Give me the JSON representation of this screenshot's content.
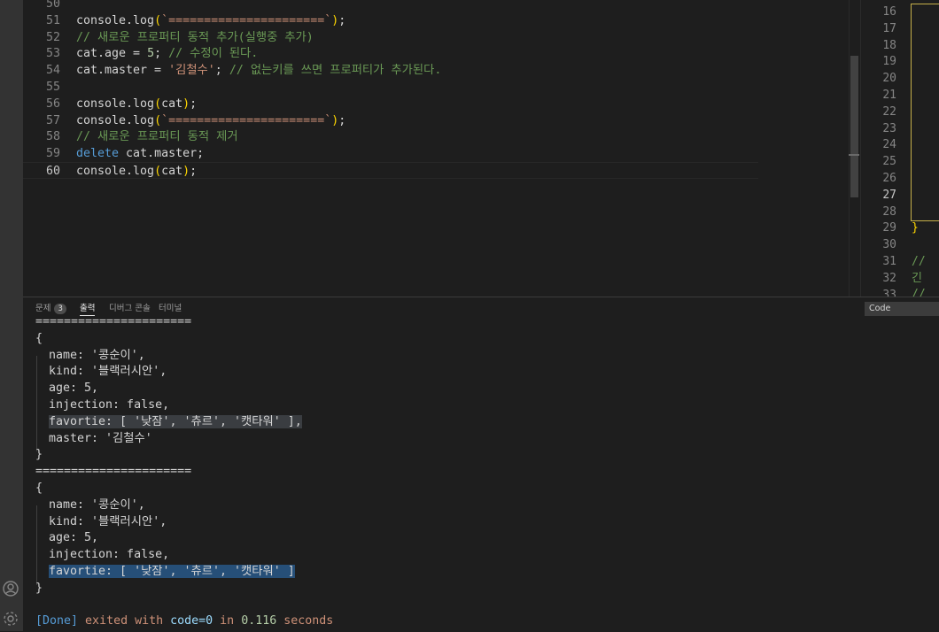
{
  "editor": {
    "lines": [
      {
        "num": "50",
        "tokens": []
      },
      {
        "num": "51",
        "tokens": [
          {
            "t": "console.log",
            "c": "tk-default"
          },
          {
            "t": "(",
            "c": "tk-punct"
          },
          {
            "t": "`======================`",
            "c": "tk-string"
          },
          {
            "t": ")",
            "c": "tk-punct"
          },
          {
            "t": ";",
            "c": "tk-default"
          }
        ]
      },
      {
        "num": "52",
        "tokens": [
          {
            "t": "// 새로운 프로퍼티 동적 추가(실행중 추가)",
            "c": "tk-comment"
          }
        ]
      },
      {
        "num": "53",
        "tokens": [
          {
            "t": "cat.age = ",
            "c": "tk-default"
          },
          {
            "t": "5",
            "c": "tk-number"
          },
          {
            "t": "; ",
            "c": "tk-default"
          },
          {
            "t": "// 수정이 된다.",
            "c": "tk-comment"
          }
        ]
      },
      {
        "num": "54",
        "tokens": [
          {
            "t": "cat.master = ",
            "c": "tk-default"
          },
          {
            "t": "'김철수'",
            "c": "tk-string"
          },
          {
            "t": "; ",
            "c": "tk-default"
          },
          {
            "t": "// 없는키를 쓰면 프로퍼티가 추가된다.",
            "c": "tk-comment"
          }
        ]
      },
      {
        "num": "55",
        "tokens": []
      },
      {
        "num": "56",
        "tokens": [
          {
            "t": "console.log",
            "c": "tk-default"
          },
          {
            "t": "(",
            "c": "tk-punct"
          },
          {
            "t": "cat",
            "c": "tk-default"
          },
          {
            "t": ")",
            "c": "tk-punct"
          },
          {
            "t": ";",
            "c": "tk-default"
          }
        ]
      },
      {
        "num": "57",
        "tokens": [
          {
            "t": "console.log",
            "c": "tk-default"
          },
          {
            "t": "(",
            "c": "tk-punct"
          },
          {
            "t": "`======================`",
            "c": "tk-string"
          },
          {
            "t": ")",
            "c": "tk-punct"
          },
          {
            "t": ";",
            "c": "tk-default"
          }
        ]
      },
      {
        "num": "58",
        "tokens": [
          {
            "t": "// 새로운 프로퍼티 동적 제거",
            "c": "tk-comment"
          }
        ]
      },
      {
        "num": "59",
        "tokens": [
          {
            "t": "delete",
            "c": "tk-keyword"
          },
          {
            "t": " cat.master;",
            "c": "tk-default"
          }
        ]
      },
      {
        "num": "60",
        "tokens": [
          {
            "t": "console.log",
            "c": "tk-default"
          },
          {
            "t": "(",
            "c": "tk-punct"
          },
          {
            "t": "cat",
            "c": "tk-default"
          },
          {
            "t": ")",
            "c": "tk-punct"
          },
          {
            "t": ";",
            "c": "tk-default"
          }
        ],
        "current": true
      }
    ]
  },
  "minimap": {
    "line_numbers": [
      "16",
      "17",
      "18",
      "19",
      "20",
      "21",
      "22",
      "23",
      "24",
      "25",
      "26",
      "27",
      "28",
      "29",
      "30",
      "31",
      "32",
      "33"
    ],
    "active_line": "27",
    "brace": "}",
    "comments": [
      "// 긴",
      "// 도"
    ]
  },
  "panel": {
    "tabs": [
      {
        "label": "문제",
        "badge": "3"
      },
      {
        "label": "출력",
        "active": true
      },
      {
        "label": "디버그 콘솔"
      },
      {
        "label": "터미널"
      }
    ],
    "output_channel": "Code",
    "output_lines": [
      {
        "text": "======================"
      },
      {
        "text": "{"
      },
      {
        "text": "name: '콩순이',",
        "indent": true
      },
      {
        "text": "kind: '블랙러시안',",
        "indent": true
      },
      {
        "text": "age: 5,",
        "indent": true
      },
      {
        "text": "injection: false,",
        "indent": true
      },
      {
        "text": "favortie: [ '낮잠', '츄르', '캣타워' ],",
        "indent": true,
        "highlight": "gray"
      },
      {
        "text": "master: '김철수'",
        "indent": true
      },
      {
        "text": "}"
      },
      {
        "text": "======================"
      },
      {
        "text": "{"
      },
      {
        "text": "name: '콩순이',",
        "indent": true
      },
      {
        "text": "kind: '블랙러시안',",
        "indent": true
      },
      {
        "text": "age: 5,",
        "indent": true
      },
      {
        "text": "injection: false,",
        "indent": true
      },
      {
        "text": "favortie: [ '낮잠', '츄르', '캣타워' ]",
        "indent": true,
        "highlight": "blue"
      },
      {
        "text": "}"
      },
      {
        "text": ""
      }
    ],
    "done": {
      "tag": "[Done]",
      "text1": " exited with ",
      "code": "code=0",
      "text2": " in ",
      "time": "0.116",
      "text3": " seconds"
    }
  }
}
